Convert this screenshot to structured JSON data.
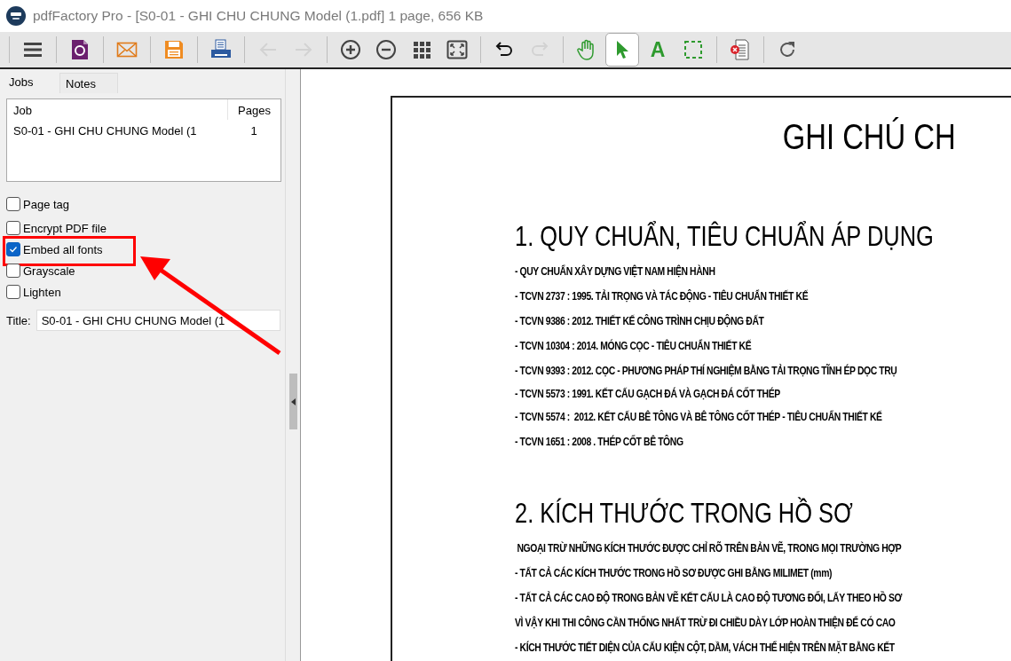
{
  "window": {
    "title": "pdfFactory Pro - [S0-01 - GHI CHU CHUNG Model (1.pdf] 1 page, 656 KB"
  },
  "toolbar": {
    "groups": [
      [
        {
          "kind": "menu",
          "disabled": false,
          "selected": false
        }
      ],
      [
        {
          "kind": "pdf",
          "disabled": false,
          "selected": false
        }
      ],
      [
        {
          "kind": "mail",
          "disabled": false,
          "selected": false
        }
      ],
      [
        {
          "kind": "save",
          "disabled": false,
          "selected": false
        }
      ],
      [
        {
          "kind": "print",
          "disabled": false,
          "selected": false
        }
      ],
      [
        {
          "kind": "back",
          "disabled": true,
          "selected": false
        },
        {
          "kind": "forward",
          "disabled": true,
          "selected": false
        }
      ],
      [
        {
          "kind": "zoom-in",
          "disabled": false,
          "selected": false
        },
        {
          "kind": "zoom-out",
          "disabled": false,
          "selected": false
        },
        {
          "kind": "grid",
          "disabled": false,
          "selected": false
        },
        {
          "kind": "fit",
          "disabled": false,
          "selected": false
        }
      ],
      [
        {
          "kind": "undo",
          "disabled": false,
          "selected": false
        },
        {
          "kind": "redo",
          "disabled": true,
          "selected": false
        }
      ],
      [
        {
          "kind": "hand",
          "disabled": false,
          "selected": false
        },
        {
          "kind": "pointer",
          "disabled": false,
          "selected": true
        },
        {
          "kind": "text",
          "label": "A",
          "disabled": false,
          "selected": false
        },
        {
          "kind": "select-area",
          "disabled": false,
          "selected": false
        }
      ],
      [
        {
          "kind": "delete-page",
          "disabled": false,
          "selected": false
        }
      ],
      [
        {
          "kind": "rotate",
          "disabled": false,
          "selected": false
        }
      ]
    ]
  },
  "sidebar": {
    "tabs": [
      {
        "label": "Jobs",
        "selected": true
      },
      {
        "label": "Notes",
        "selected": false
      }
    ],
    "jobs": {
      "columns": [
        "Job",
        "Pages"
      ],
      "rows": [
        {
          "job": "S0-01 - GHI CHU CHUNG Model (1",
          "pages": "1"
        }
      ]
    },
    "options": [
      {
        "label": "Page tag",
        "checked": false,
        "highlighted": false
      },
      {
        "label": "Encrypt PDF file",
        "checked": false,
        "highlighted": false
      },
      {
        "label": "Embed all fonts",
        "checked": true,
        "highlighted": true
      },
      {
        "label": "Grayscale",
        "checked": false,
        "highlighted": false
      },
      {
        "label": "Lighten",
        "checked": false,
        "highlighted": false
      }
    ],
    "title_field": {
      "label": "Title:",
      "value": "S0-01 - GHI CHU CHUNG Model (1"
    }
  },
  "document": {
    "title": "GHI CHÚ CH",
    "sections": [
      {
        "heading": "1. QUY CHUẨN, TIÊU CHUẨN ÁP DỤNG",
        "lines": [
          "- QUY CHUẨN XÂY DỰNG VIỆT NAM HIỆN HÀNH",
          "- TCVN 2737 : 1995. TẢI TRỌNG VÀ TÁC ĐỘNG - TIÊU CHUẨN THIẾT KẾ",
          "- TCVN 9386 : 2012. THIẾT KẾ CÔNG TRÌNH CHỊU ĐỘNG ĐẤT",
          "- TCVN 10304 : 2014. MÓNG CỌC - TIÊU CHUẨN THIẾT KẾ",
          "- TCVN 9393 : 2012. CỌC - PHƯƠNG PHÁP THÍ NGHIỆM BẰNG TẢI TRỌNG TĨNH ÉP DỌC TRỤ",
          "- TCVN 5573 : 1991. KẾT CẤU GẠCH ĐÁ VÀ GẠCH ĐÁ CỐT THÉP",
          "- TCVN 5574 :  2012. KẾT CẤU BÊ TÔNG VÀ BÊ TÔNG CỐT THÉP - TIÊU CHUẨN THIẾT KẾ",
          "- TCVN 1651 : 2008 . THÉP CỐT BÊ TÔNG"
        ]
      },
      {
        "heading": "2. KÍCH THƯỚC TRONG HỒ SƠ",
        "lines": [
          " NGOẠI TRỪ NHỮNG KÍCH THƯỚC ĐƯỢC CHỈ RÕ TRÊN BẢN VẼ, TRONG MỌI TRƯỜNG HỢP",
          "- TẤT CẢ CÁC KÍCH THƯỚC TRONG HỒ SƠ ĐƯỢC GHI BẰNG MILIMET (mm)",
          "- TẤT CẢ CÁC CAO ĐỘ TRONG BẢN VẼ KẾT CẤU LÀ CAO ĐỘ TƯƠNG ĐỐI, LẤY THEO HỒ SƠ",
          "VÌ VẬY KHI THI CÔNG CẦN THỐNG NHẤT TRỪ ĐI CHIỀU DÀY LỚP HOÀN THIỆN ĐỂ CÓ CAO",
          "- KÍCH THƯỚC TIẾT DIỆN CỦA CẤU KIỆN CỘT, DẦM, VÁCH THỂ HIỆN TRÊN MẶT BẰNG KẾT"
        ]
      }
    ]
  }
}
